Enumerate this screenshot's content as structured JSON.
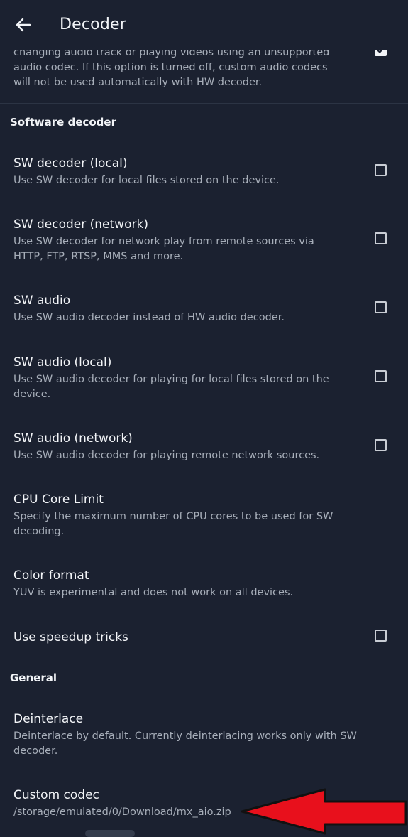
{
  "appbar": {
    "title": "Decoder"
  },
  "top_item": {
    "lines": [
      "changing audio track or playing videos using an unsupported",
      "audio codec. If this option is turned off, custom audio codecs",
      "will not be used automatically with HW decoder."
    ],
    "checked": true
  },
  "sections": {
    "software": "Software decoder",
    "general": "General"
  },
  "items": [
    {
      "title": "SW decoder (local)",
      "summary": [
        "Use SW decoder for local files stored on the device."
      ],
      "checked": false
    },
    {
      "title": "SW decoder (network)",
      "summary": [
        "Use SW decoder for network play from remote sources via",
        "HTTP, FTP, RTSP, MMS and more."
      ],
      "checked": false
    },
    {
      "title": "SW audio",
      "summary": [
        "Use SW audio decoder instead of HW audio decoder."
      ],
      "checked": false
    },
    {
      "title": "SW audio (local)",
      "summary": [
        "Use SW audio decoder for playing for local files stored on the",
        "device."
      ],
      "checked": false
    },
    {
      "title": "SW audio (network)",
      "summary": [
        "Use SW audio decoder for playing remote network sources."
      ],
      "checked": false
    },
    {
      "title": "CPU Core Limit",
      "summary": [
        "Specify the maximum number of CPU cores to be used for SW",
        "decoding."
      ]
    },
    {
      "title": "Color format",
      "summary": [
        "YUV is experimental and does not work on all devices."
      ]
    },
    {
      "title": "Use speedup tricks",
      "checked": false
    },
    {
      "title": "Deinterlace",
      "summary": [
        "Deinterlace by default. Currently deinterlacing works only with SW",
        "decoder."
      ]
    },
    {
      "title": "Custom codec",
      "summary": [
        "/storage/emulated/0/Download/mx_aio.zip"
      ]
    }
  ],
  "colors": {
    "background": "#1b2130",
    "annotation_arrow": "#e8101c"
  },
  "icons": {
    "back": "arrow-left-icon",
    "annotation": "red-arrow-annotation-icon"
  }
}
